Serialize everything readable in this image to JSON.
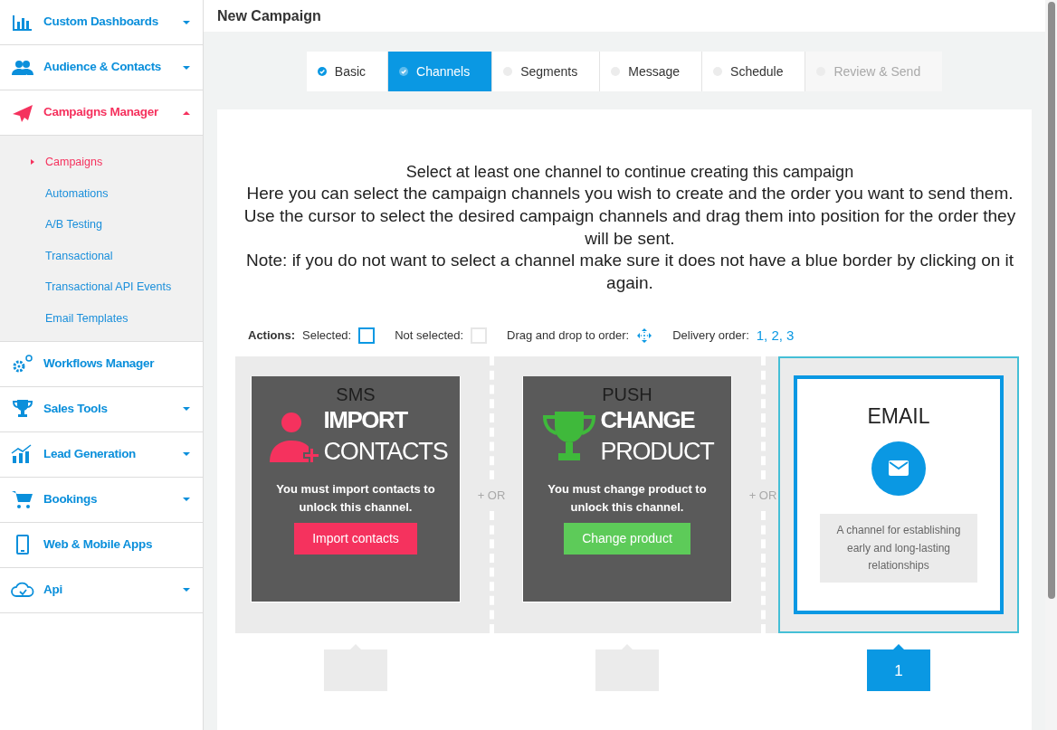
{
  "sidebar": {
    "items": [
      {
        "label": "Custom Dashboards",
        "expanded": false,
        "selected": false
      },
      {
        "label": "Audience & Contacts",
        "expanded": false,
        "selected": false
      },
      {
        "label": "Campaigns Manager",
        "expanded": true,
        "selected": true,
        "children": [
          {
            "label": "Campaigns",
            "selected": true
          },
          {
            "label": "Automations",
            "selected": false
          },
          {
            "label": "A/B Testing",
            "selected": false
          },
          {
            "label": "Transactional",
            "selected": false
          },
          {
            "label": "Transactional API Events",
            "selected": false
          },
          {
            "label": "Email Templates",
            "selected": false
          }
        ]
      },
      {
        "label": "Workflows Manager",
        "selected": false
      },
      {
        "label": "Sales Tools",
        "expanded": false,
        "selected": false
      },
      {
        "label": "Lead Generation",
        "expanded": false,
        "selected": false
      },
      {
        "label": "Bookings",
        "expanded": false,
        "selected": false
      },
      {
        "label": "Web & Mobile Apps",
        "selected": false
      },
      {
        "label": "Api",
        "expanded": false,
        "selected": false
      }
    ]
  },
  "header": {
    "title": "New Campaign"
  },
  "steps": [
    {
      "label": "Basic",
      "completed": true,
      "selected": false,
      "disabled": false
    },
    {
      "label": "Channels",
      "completed": true,
      "selected": true,
      "disabled": false
    },
    {
      "label": "Segments",
      "completed": false,
      "selected": false,
      "disabled": false
    },
    {
      "label": "Message",
      "completed": false,
      "selected": false,
      "disabled": false
    },
    {
      "label": "Schedule",
      "completed": false,
      "selected": false,
      "disabled": false
    },
    {
      "label": "Review & Send",
      "completed": false,
      "selected": false,
      "disabled": true
    }
  ],
  "intro": {
    "lead": "Select at least one channel to continue creating this campaign",
    "lines": [
      "Here you can select the campaign channels you wish to create and the order you want to send them.",
      "Use the cursor to select the desired campaign channels and drag them into position for the order they will be sent.",
      "Note: if you do not want to select a channel make sure it does not have a blue border by clicking on it again."
    ]
  },
  "legend": {
    "label": "Actions:",
    "items": [
      {
        "kind": "selected",
        "label": "Selected:"
      },
      {
        "kind": "unselected",
        "label": "Not selected:"
      },
      {
        "kind": "drag",
        "label": "Drag and drop to order:"
      },
      {
        "kind": "order",
        "label": "Delivery order:",
        "value": "1, 2, 3"
      }
    ]
  },
  "separators": [
    "+ OR",
    "+ OR"
  ],
  "channels": [
    {
      "title": "SMS",
      "selected": false,
      "lock": {
        "kind": "import",
        "heading_bold": "IMPORT",
        "heading": "CONTACTS",
        "message": "You must import contacts to unlock this channel.",
        "button": "Import contacts"
      }
    },
    {
      "title": "PUSH",
      "selected": false,
      "lock": {
        "kind": "product",
        "heading_bold": "CHANGE",
        "heading": "PRODUCT",
        "message": "You must change product to unlock this channel.",
        "button": "Change product"
      }
    },
    {
      "title": "EMAIL",
      "selected": true,
      "description": "A channel for establishing early and long-lasting relationships",
      "order": "1"
    }
  ]
}
